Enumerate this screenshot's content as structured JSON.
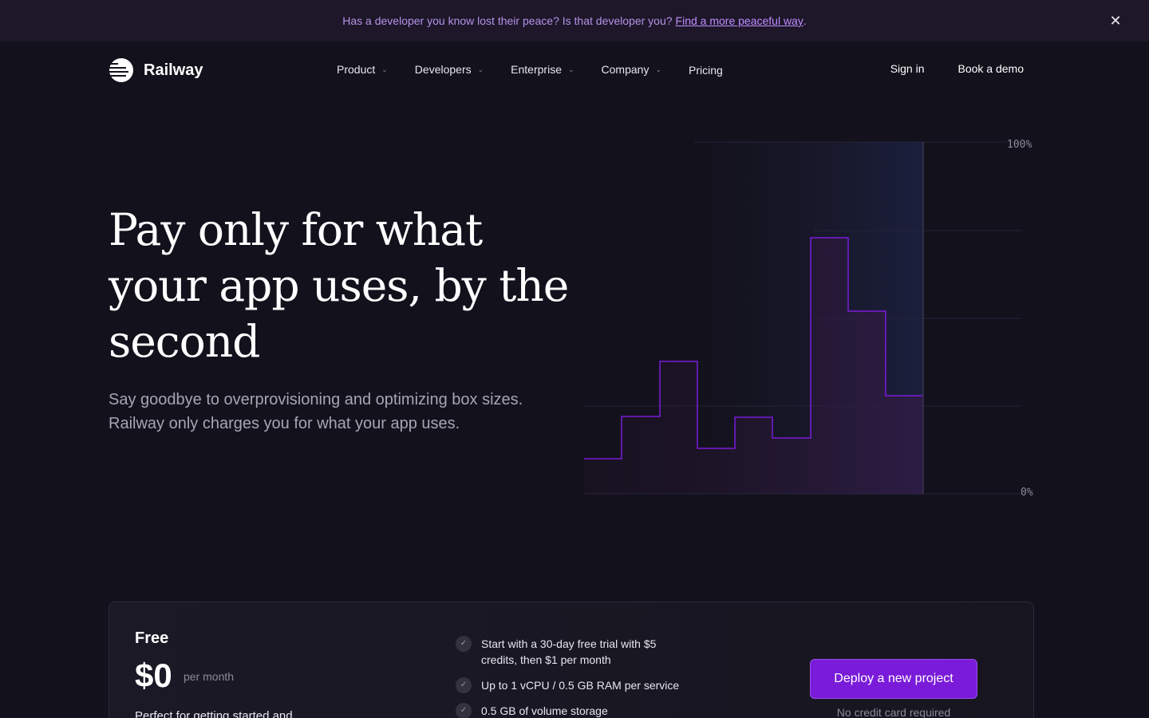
{
  "banner": {
    "text": "Has a developer you know lost their peace? Is that developer you?",
    "link": "Find a more peaceful way",
    "suffix": ".",
    "close_icon": "close-icon"
  },
  "header": {
    "brand": "Railway",
    "nav": [
      {
        "label": "Product",
        "has_dropdown": true
      },
      {
        "label": "Developers",
        "has_dropdown": true
      },
      {
        "label": "Enterprise",
        "has_dropdown": true
      },
      {
        "label": "Company",
        "has_dropdown": true
      },
      {
        "label": "Pricing",
        "has_dropdown": false
      }
    ],
    "sign_in": "Sign in",
    "book_demo": "Book a demo"
  },
  "hero": {
    "title": "Pay only for what your app uses, by the second",
    "subtitle": "Say goodbye to overprovisioning and optimizing box sizes. Railway only charges you for what your app uses."
  },
  "chart": {
    "y_max_label": "100%",
    "y_min_label": "0%",
    "line_color": "#7a1bd9"
  },
  "pricing": {
    "plan": "Free",
    "price": "$0",
    "period": "per month",
    "description": "Perfect for getting started and",
    "features": [
      "Start with a 30-day free trial with $5 credits, then $1 per month",
      "Up to 1 vCPU / 0.5 GB RAM per service",
      "0.5 GB of volume storage"
    ],
    "cta": "Deploy a new project",
    "cta_note": "No credit card required",
    "accent": "#7a1bd9"
  }
}
